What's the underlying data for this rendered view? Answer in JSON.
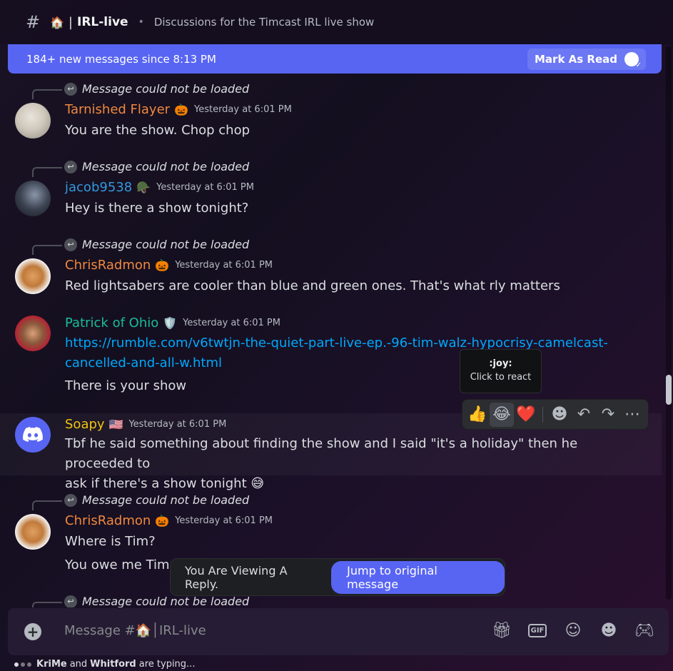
{
  "header": {
    "channel_emoji": "🏠",
    "channel_name": "IRL-live",
    "topic": "Discussions for the Timcast IRL live show"
  },
  "banner": {
    "text": "184+ new messages since 8:13 PM",
    "mark_as_read": "Mark As Read"
  },
  "reply_placeholder": "Message could not be loaded",
  "messages": [
    {
      "author": "Tarnished Flayer",
      "author_color": "#f0883e",
      "badge": "🎃",
      "timestamp": "Yesterday at 6:01 PM",
      "lines": [
        "You are the show. Chop chop"
      ],
      "has_reply": true
    },
    {
      "author": "jacob9538",
      "author_color": "#3498db",
      "badge": "🪖",
      "timestamp": "Yesterday at 6:01 PM",
      "lines": [
        "Hey is there a show tonight?"
      ],
      "has_reply": true
    },
    {
      "author": "ChrisRadmon",
      "author_color": "#f0883e",
      "badge": "🎃",
      "timestamp": "Yesterday at 6:01 PM",
      "lines": [
        "Red lightsabers are cooler than blue and green ones. That's what rly matters"
      ],
      "has_reply": true
    },
    {
      "author": "Patrick of Ohio",
      "author_color": "#1abc9c",
      "badge": "🛡️",
      "timestamp": "Yesterday at 6:01 PM",
      "link": "https://rumble.com/v6twtjn-the-quiet-part-live-ep.-96-tim-walz-hypocrisy-camelcast-cancelled-and-all-w.html",
      "link_line1": "https://rumble.com/v6twtjn-the-quiet-part-live-ep.-96-tim-walz-hypocrisy-camelcast-",
      "link_line2": "cancelled-and-all-w.html",
      "lines": [
        "There is your show"
      ],
      "has_reply": false
    },
    {
      "author": "Soapy",
      "author_color": "#f1c40f",
      "badge": "🇺🇸",
      "timestamp": "Yesterday at 6:01 PM",
      "lines": [
        "Tbf he said something about finding the show and I said \"it's a holiday\" then he proceeded to",
        "ask if there's a show tonight 😅"
      ],
      "has_reply": false
    },
    {
      "author": "ChrisRadmon",
      "author_color": "#f0883e",
      "badge": "🎃",
      "timestamp": "Yesterday at 6:01 PM",
      "lines": [
        "Where is Tim?",
        "You owe me Tim r"
      ],
      "has_reply": true
    }
  ],
  "tooltip": {
    "name": ":joy:",
    "sub": "Click to react"
  },
  "actions": {
    "reactions": [
      "👍",
      "😂",
      "❤️"
    ],
    "add_reaction": "☻",
    "reply": "↶",
    "forward": "↷",
    "more": "⋯"
  },
  "reply_notice": {
    "text": "You Are Viewing A Reply.",
    "button": "Jump to original message"
  },
  "composer": {
    "placeholder": "Message #🏠│IRL-live"
  },
  "typing": {
    "user1": "KriMe",
    "and": "and",
    "user2": "Whitford",
    "suffix": "are typing..."
  }
}
